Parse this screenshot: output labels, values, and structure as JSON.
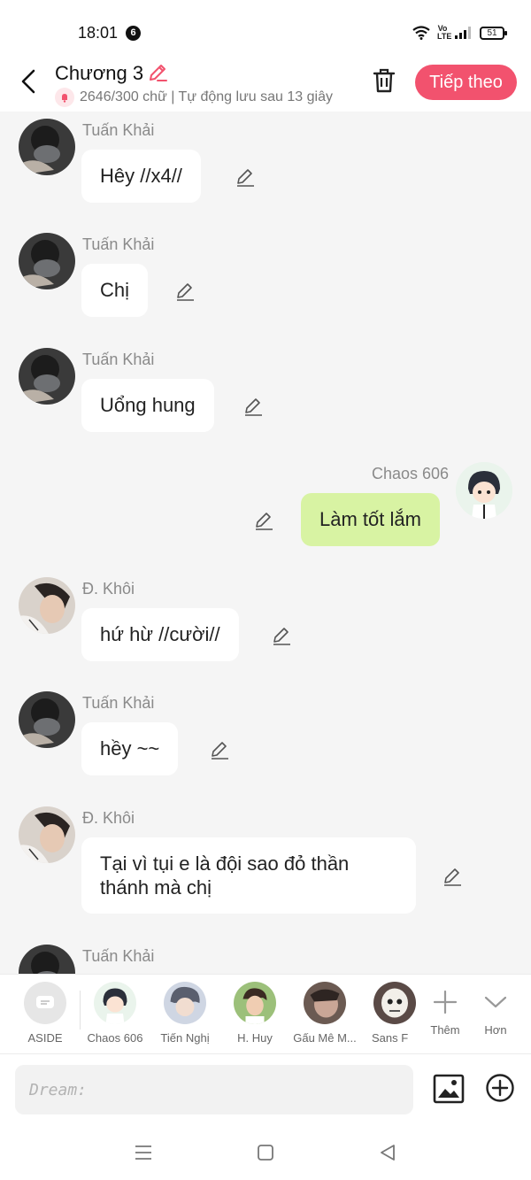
{
  "status": {
    "time": "18:01",
    "notif_count": "6",
    "network_label": "Vo LTE",
    "battery": "51"
  },
  "header": {
    "title": "Chương 3",
    "subline": "2646/300 chữ | Tự động lưu sau 13 giây",
    "next_label": "Tiếp theo"
  },
  "messages": [
    {
      "sender": "Tuấn Khải",
      "text": "Hêy //x4//",
      "side": "left"
    },
    {
      "sender": "Tuấn Khải",
      "text": "Chị",
      "side": "left"
    },
    {
      "sender": "Tuấn Khải",
      "text": "Uổng hung",
      "side": "left"
    },
    {
      "sender": "Chaos 606",
      "text": "Làm tốt lắm",
      "side": "right"
    },
    {
      "sender": "Đ. Khôi",
      "text": "hứ hừ //cười//",
      "side": "left"
    },
    {
      "sender": "Tuấn Khải",
      "text": "hềy ~~",
      "side": "left"
    },
    {
      "sender": "Đ. Khôi",
      "text": "Tại vì tụi e là đội sao đỏ thần thánh mà chị",
      "side": "left"
    },
    {
      "sender": "Tuấn Khải",
      "text": "",
      "side": "left"
    }
  ],
  "characters": [
    {
      "label": "ASIDE"
    },
    {
      "label": "Chaos 606"
    },
    {
      "label": "Tiến Nghị"
    },
    {
      "label": "H. Huy"
    },
    {
      "label": "Gấu Mê M..."
    },
    {
      "label": "Sans F"
    }
  ],
  "tools": {
    "more_label": "Thêm",
    "less_label": "Hơn"
  },
  "input": {
    "placeholder": "Dream:"
  },
  "colors": {
    "accent": "#f2526e",
    "my_bubble": "#d8f3a3",
    "background": "#f5f5f5"
  }
}
